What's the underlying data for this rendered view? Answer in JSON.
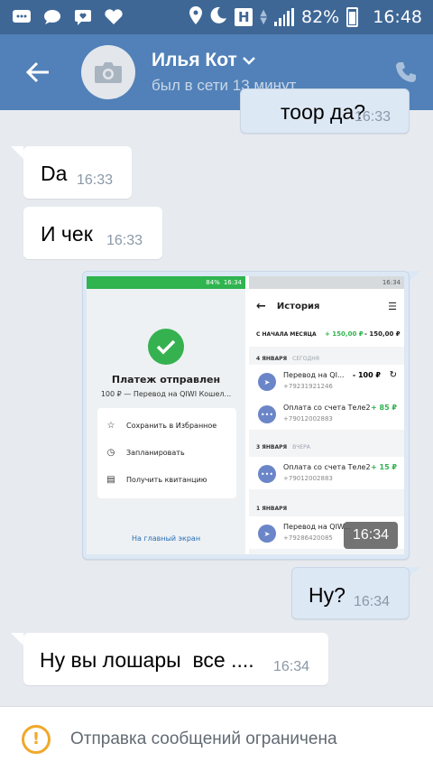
{
  "status_bar": {
    "battery": "82%",
    "time": "16:48",
    "network_badge": "H",
    "icons": [
      "message-square-icon",
      "chat-bubble-icon",
      "chat-heart-icon",
      "heart-icon",
      "location-icon",
      "moon-icon"
    ]
  },
  "header": {
    "name": "Илья Кот",
    "status": "был в сети 13 минут...",
    "icons": [
      "back-arrow-icon",
      "camera-icon",
      "chevron-down-icon",
      "phone-icon"
    ]
  },
  "messages": [
    {
      "id": "m0",
      "dir": "out",
      "text": "тоор да?",
      "time": "16:33"
    },
    {
      "id": "m1",
      "dir": "in",
      "text": "Da",
      "time": "16:33"
    },
    {
      "id": "m2",
      "dir": "in",
      "text": "И чек",
      "time": "16:33"
    },
    {
      "id": "m3",
      "dir": "out",
      "type": "image",
      "time": "16:34"
    },
    {
      "id": "m4",
      "dir": "out",
      "text": "Ну?",
      "time": "16:34"
    },
    {
      "id": "m5",
      "dir": "in",
      "text": "Ну вы лошары  все ....",
      "time": "16:34"
    }
  ],
  "screenshot": {
    "left": {
      "status_battery": "84%",
      "status_time": "16:34",
      "title": "Платеж отправлен",
      "subtitle": "100 ₽ — Перевод на QIWI Кошел...",
      "options": [
        "Сохранить в Избранное",
        "Запланировать",
        "Получить квитанцию"
      ],
      "link": "На главный экран"
    },
    "right": {
      "status_time": "16:34",
      "title": "История",
      "summary_label": "С НАЧАЛА МЕСЯЦА",
      "summary_in": "+ 150,00 ₽",
      "summary_out": "- 150,00 ₽",
      "sections": [
        {
          "date": "4 ЯНВАРЯ",
          "day": "СЕГОДНЯ"
        },
        {
          "date": "3 ЯНВАРЯ",
          "day": "ВЧЕРА"
        },
        {
          "date": "1 ЯНВАРЯ",
          "day": ""
        }
      ],
      "transactions": [
        {
          "title": "Перевод на QI...",
          "phone": "+79231921246",
          "amount": "- 100 ₽"
        },
        {
          "title": "Оплата со счета Теле2",
          "phone": "+79012002883",
          "amount": "+ 85 ₽"
        },
        {
          "title": "Оплата со счета Теле2",
          "phone": "+79012002883",
          "amount": "+ 15 ₽"
        },
        {
          "title": "Перевод на QIW...",
          "phone": "+79286420085",
          "amount": ""
        }
      ]
    }
  },
  "notice": {
    "text": "Отправка сообщений ограничена",
    "icon": "warning-icon"
  },
  "colors": {
    "status_bar": "#3e6796",
    "app_bar": "#5181b8",
    "background": "#e7ebf0",
    "outgoing_bubble": "#dde8f5",
    "incoming_bubble": "#ffffff",
    "warning": "#f0a829",
    "qiwi_green": "#2fb44f"
  }
}
